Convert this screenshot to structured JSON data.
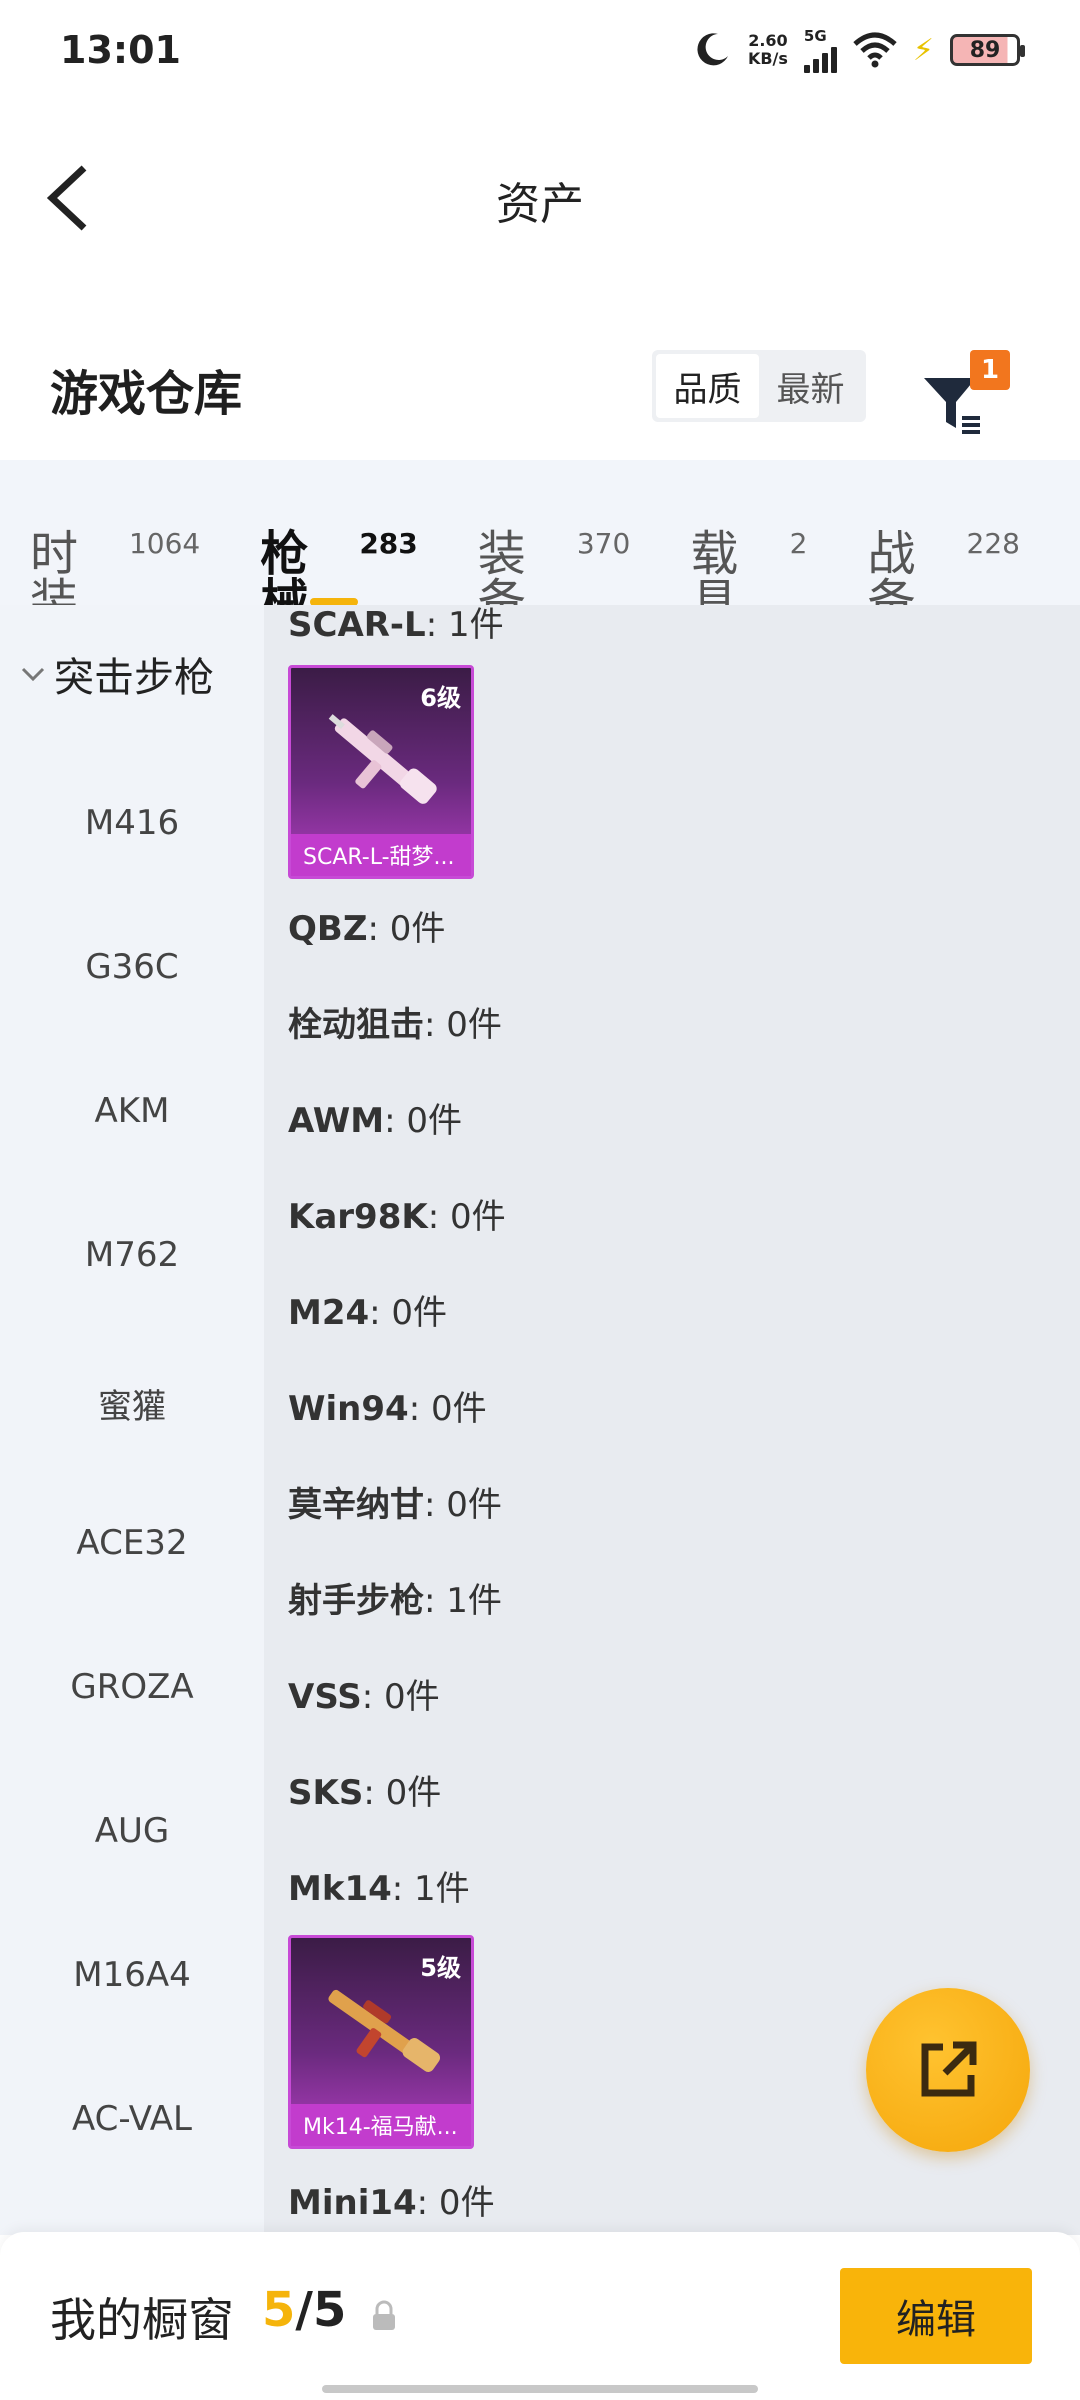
{
  "status_bar": {
    "time": "13:01",
    "net_speed": "2.60",
    "net_unit": "KB/s",
    "signal": "5G",
    "battery": "89"
  },
  "header": {
    "title": "资产"
  },
  "warehouse": {
    "title": "游戏仓库",
    "sort_quality": "品质",
    "sort_latest": "最新",
    "filter_badge": "1"
  },
  "tabs": [
    {
      "label": "时装",
      "count": "1064"
    },
    {
      "label": "枪械",
      "count": "283"
    },
    {
      "label": "装备",
      "count": "370"
    },
    {
      "label": "载具",
      "count": "2"
    },
    {
      "label": "战备",
      "count": "228"
    }
  ],
  "sidebar": {
    "category": "突击步枪",
    "items": [
      "M416",
      "G36C",
      "AKM",
      "M762",
      "蜜獾",
      "ACE32",
      "GROZA",
      "AUG",
      "M16A4",
      "AC-VAL"
    ]
  },
  "content": {
    "rows": [
      {
        "name": "SCAR-L",
        "count": ": 1件"
      },
      {
        "name": "QBZ",
        "count": ": 0件"
      },
      {
        "name": "栓动狙击",
        "count": ": 0件"
      },
      {
        "name": "AWM",
        "count": ": 0件"
      },
      {
        "name": "Kar98K",
        "count": ": 0件"
      },
      {
        "name": "M24",
        "count": ": 0件"
      },
      {
        "name": "Win94",
        "count": ": 0件"
      },
      {
        "name": "莫辛纳甘",
        "count": ": 0件"
      },
      {
        "name": "射手步枪",
        "count": ": 1件"
      },
      {
        "name": "VSS",
        "count": ": 0件"
      },
      {
        "name": "SKS",
        "count": ": 0件"
      },
      {
        "name": "Mk14",
        "count": ": 1件"
      },
      {
        "name": "Mini14",
        "count": ": 0件"
      }
    ],
    "cards": [
      {
        "level": "6级",
        "name": "SCAR-L-甜梦..."
      },
      {
        "level": "5级",
        "name": "Mk14-福马献..."
      }
    ]
  },
  "bottom": {
    "showcase_label": "我的橱窗",
    "showcase_current": "5",
    "showcase_total": "/5",
    "edit_label": "编辑"
  }
}
